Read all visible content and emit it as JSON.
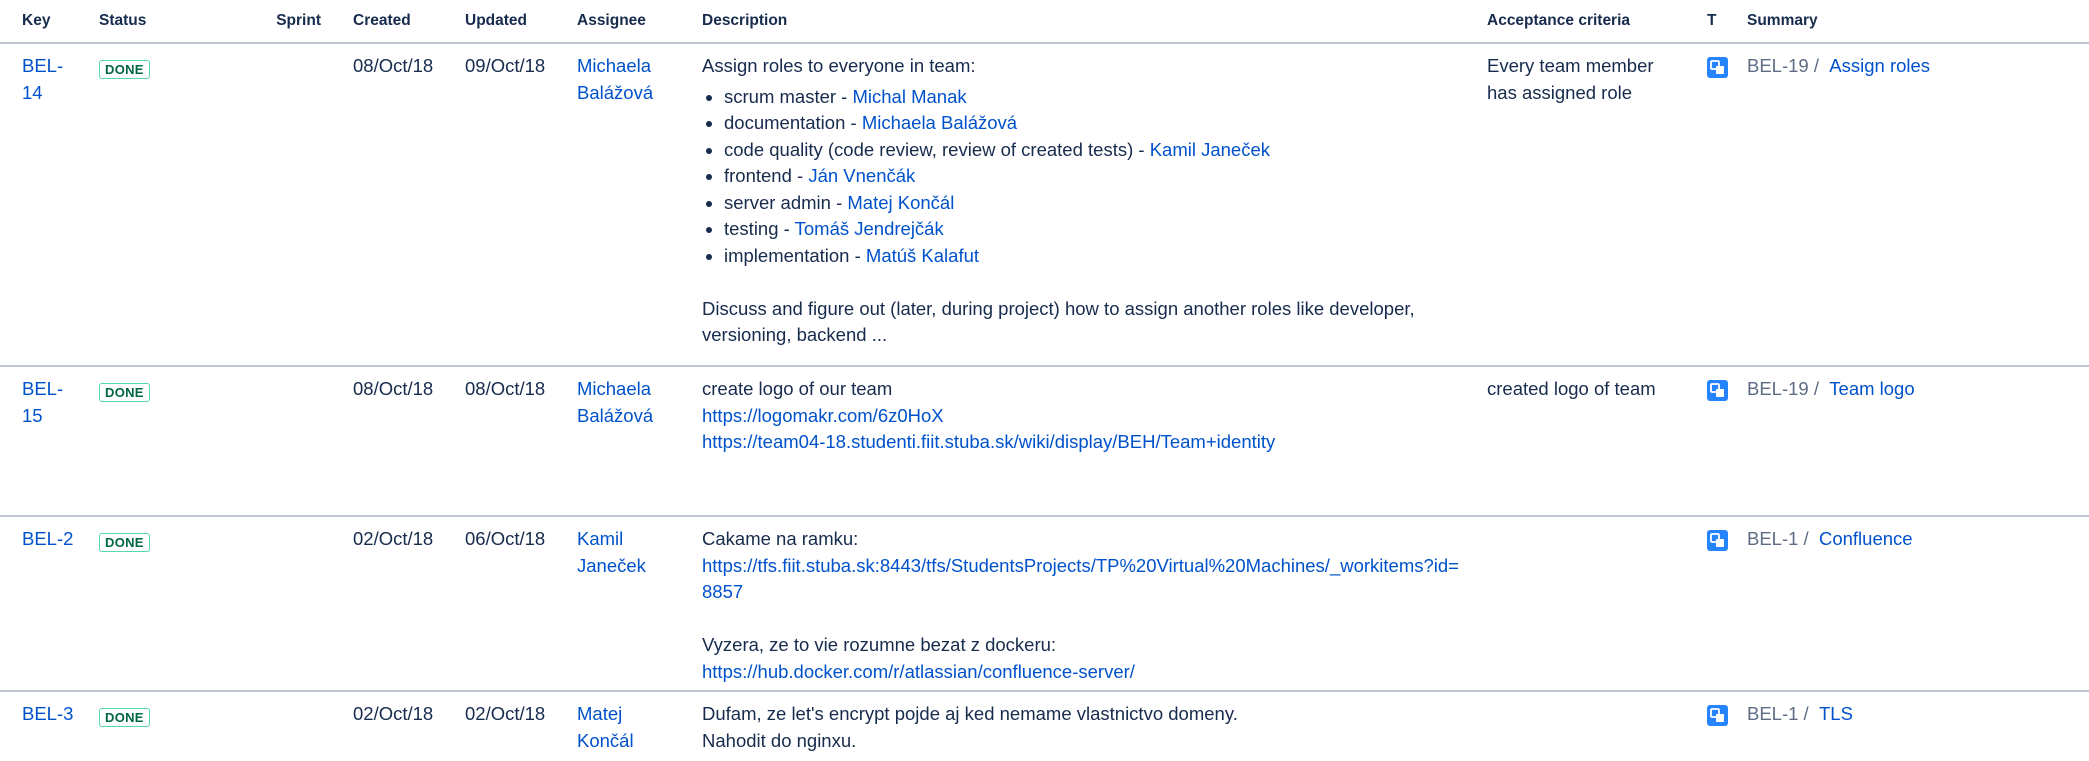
{
  "columns": {
    "key": "Key",
    "status": "Status",
    "sprint": "Sprint",
    "created": "Created",
    "updated": "Updated",
    "assignee": "Assignee",
    "description": "Description",
    "acceptance": "Acceptance criteria",
    "type": "T",
    "summary": "Summary"
  },
  "rows": [
    {
      "key": "BEL-14",
      "status": "DONE",
      "created": "08/Oct/18",
      "updated": "09/Oct/18",
      "assignee_first": "Michaela",
      "assignee_last": "Balážová",
      "description": {
        "intro": "Assign roles to everyone in team:",
        "roles": [
          {
            "role": "scrum master - ",
            "person": "Michal Manak"
          },
          {
            "role": "documentation - ",
            "person": "Michaela Balážová"
          },
          {
            "role": "code quality (code review, review of created tests) - ",
            "person": "Kamil Janeček"
          },
          {
            "role": "frontend - ",
            "person": "Ján Vnenčák"
          },
          {
            "role": "server admin - ",
            "person": "Matej Končál"
          },
          {
            "role": "testing - ",
            "person": "Tomáš Jendrejčák"
          },
          {
            "role": "implementation - ",
            "person": "Matúš Kalafut"
          }
        ],
        "outro": "Discuss and figure out (later, during project) how to assign another roles like developer, versioning, backend ..."
      },
      "acceptance": "Every team member has assigned role",
      "type_icon": "subtask-icon",
      "parent": "BEL-19 /",
      "summary": "Assign roles"
    },
    {
      "key": "BEL-15",
      "status": "DONE",
      "created": "08/Oct/18",
      "updated": "08/Oct/18",
      "assignee_first": "Michaela",
      "assignee_last": "Balážová",
      "description": {
        "line1": "create logo of our team",
        "link1": "https://logomakr.com/6z0HoX",
        "link2": "https://team04-18.studenti.fiit.stuba.sk/wiki/display/BEH/Team+identity"
      },
      "acceptance": "created logo of team",
      "type_icon": "subtask-icon",
      "parent": "BEL-19 /",
      "summary": "Team logo"
    },
    {
      "key": "BEL-2",
      "status": "DONE",
      "created": "02/Oct/18",
      "updated": "06/Oct/18",
      "assignee_first": "Kamil",
      "assignee_last": "Janeček",
      "description": {
        "line1": "Cakame na ramku:",
        "link1": "https://tfs.fiit.stuba.sk:8443/tfs/StudentsProjects/TP%20Virtual%20Machines/_workitems?id=8857",
        "line2": "Vyzera, ze to vie rozumne bezat z dockeru:",
        "link2": "https://hub.docker.com/r/atlassian/confluence-server/"
      },
      "acceptance": "",
      "type_icon": "subtask-icon",
      "parent": "BEL-1 /",
      "summary": "Confluence"
    },
    {
      "key": "BEL-3",
      "status": "DONE",
      "created": "02/Oct/18",
      "updated": "02/Oct/18",
      "assignee_first": "Matej",
      "assignee_last": "Končál",
      "description": {
        "line1": "Dufam, ze let's encrypt pojde aj ked nemame vlastnictvo domeny.",
        "line2": "Nahodit do nginxu."
      },
      "acceptance": "",
      "type_icon": "subtask-icon",
      "parent": "BEL-1 /",
      "summary": "TLS"
    }
  ],
  "colors": {
    "link": "#0052cc",
    "text": "#172b4d",
    "done_text": "#006644",
    "done_border": "#57d9a3",
    "subtask_icon": "#2684ff",
    "row_border": "#c1c7d0"
  }
}
